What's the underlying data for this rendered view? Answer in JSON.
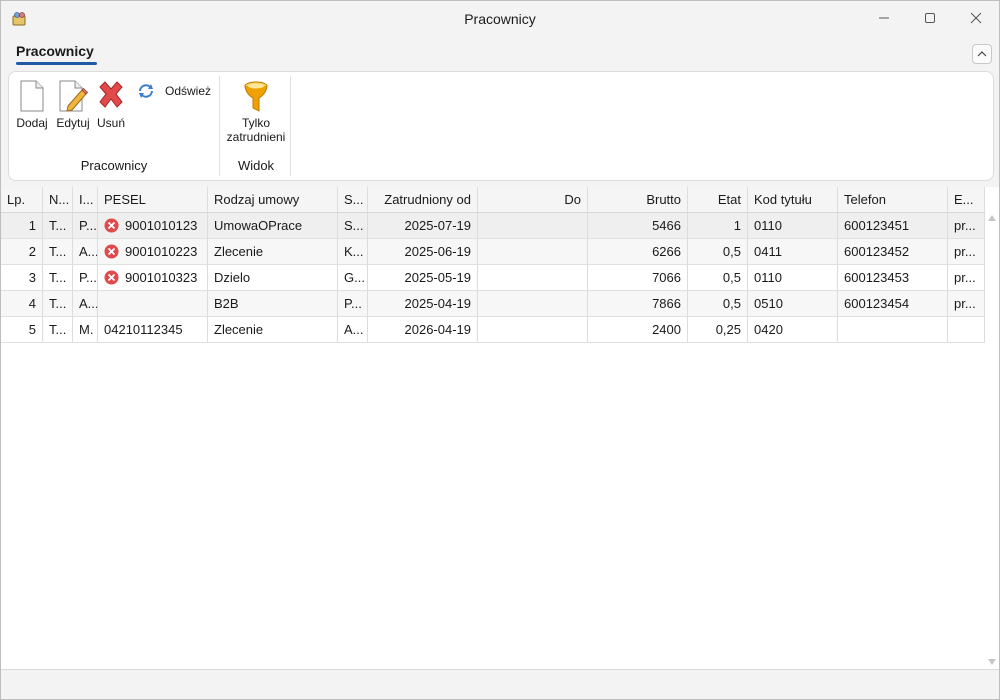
{
  "window": {
    "title": "Pracownicy"
  },
  "ribbon": {
    "tab_label": "Pracownicy",
    "groups": [
      {
        "label": "Pracownicy"
      },
      {
        "label": "Widok"
      }
    ],
    "buttons": {
      "add": "Dodaj",
      "edit": "Edytuj",
      "delete": "Usuń",
      "refresh": "Odśwież",
      "filter_line1": "Tylko",
      "filter_line2": "zatrudnieni"
    }
  },
  "grid": {
    "columns": [
      "Lp.",
      "N...",
      "I...",
      "PESEL",
      "Rodzaj umowy",
      "S...",
      "Zatrudniony od",
      "Do",
      "Brutto",
      "Etat",
      "Kod tytułu",
      "Telefon",
      "E..."
    ],
    "rows": [
      {
        "lp": "1",
        "n": "T...",
        "i": "P...",
        "pesel": "9001010123",
        "pesel_error": true,
        "umowa": "UmowaOPrace",
        "s": "S...",
        "od": "2025-07-19",
        "do": "",
        "brutto": "5466",
        "etat": "1",
        "kod": "0110",
        "telefon": "600123451",
        "e": "pr..."
      },
      {
        "lp": "2",
        "n": "T...",
        "i": "A...",
        "pesel": "9001010223",
        "pesel_error": true,
        "umowa": "Zlecenie",
        "s": "K...",
        "od": "2025-06-19",
        "do": "",
        "brutto": "6266",
        "etat": "0,5",
        "kod": "0411",
        "telefon": "600123452",
        "e": "pr..."
      },
      {
        "lp": "3",
        "n": "T...",
        "i": "P...",
        "pesel": "9001010323",
        "pesel_error": true,
        "umowa": "Dzielo",
        "s": "G...",
        "od": "2025-05-19",
        "do": "",
        "brutto": "7066",
        "etat": "0,5",
        "kod": "0110",
        "telefon": "600123453",
        "e": "pr..."
      },
      {
        "lp": "4",
        "n": "T...",
        "i": "A...",
        "pesel": "",
        "pesel_error": false,
        "umowa": "B2B",
        "s": "P...",
        "od": "2025-04-19",
        "do": "",
        "brutto": "7866",
        "etat": "0,5",
        "kod": "0510",
        "telefon": "600123454",
        "e": "pr..."
      },
      {
        "lp": "5",
        "n": "T...",
        "i": "M.",
        "pesel": "04210112345",
        "pesel_error": false,
        "umowa": "Zlecenie",
        "s": "A...",
        "od": "2026-04-19",
        "do": "",
        "brutto": "2400",
        "etat": "0,25",
        "kod": "0420",
        "telefon": "",
        "e": ""
      }
    ]
  },
  "icons": {
    "app": "app-icon",
    "add": "new-document-icon",
    "edit": "edit-document-icon",
    "delete": "red-x-icon",
    "refresh": "refresh-icon",
    "filter": "funnel-icon",
    "error": "error-circle-icon"
  },
  "colors": {
    "accent": "#1f5aa6",
    "error": "#e04a4a",
    "funnel": "#f0a000"
  }
}
